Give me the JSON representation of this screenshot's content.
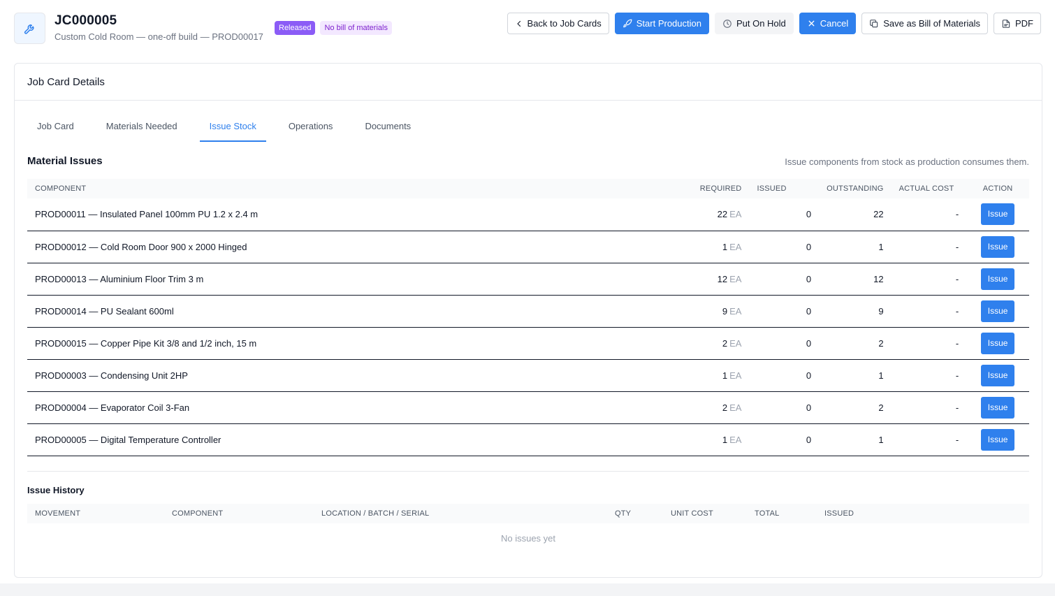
{
  "header": {
    "code": "JC000005",
    "subtitle": "Custom Cold Room — one-off build — PROD00017",
    "icon": "wrench-icon",
    "badges": {
      "status": "Released",
      "bom": "No bill of materials"
    }
  },
  "actions": {
    "back": "Back to Job Cards",
    "start": "Start Production",
    "hold": "Put On Hold",
    "cancel": "Cancel",
    "save_bom": "Save as Bill of Materials",
    "pdf": "PDF"
  },
  "card": {
    "title": "Job Card Details"
  },
  "tabs": [
    "Job Card",
    "Materials Needed",
    "Issue Stock",
    "Operations",
    "Documents"
  ],
  "active_tab": "Issue Stock",
  "material_issues": {
    "title": "Material Issues",
    "hint": "Issue components from stock as production consumes them.",
    "columns": [
      "Component",
      "Required",
      "Issued",
      "Outstanding",
      "Actual Cost",
      "Action"
    ],
    "rows": [
      {
        "component": "PROD00011 — Insulated Panel 100mm PU 1.2 x 2.4 m",
        "required": "22",
        "unit": "EA",
        "issued": "0",
        "outstanding": "22",
        "actual_cost": "-",
        "action": "Issue"
      },
      {
        "component": "PROD00012 — Cold Room Door 900 x 2000 Hinged",
        "required": "1",
        "unit": "EA",
        "issued": "0",
        "outstanding": "1",
        "actual_cost": "-",
        "action": "Issue"
      },
      {
        "component": "PROD00013 — Aluminium Floor Trim 3 m",
        "required": "12",
        "unit": "EA",
        "issued": "0",
        "outstanding": "12",
        "actual_cost": "-",
        "action": "Issue"
      },
      {
        "component": "PROD00014 — PU Sealant 600ml",
        "required": "9",
        "unit": "EA",
        "issued": "0",
        "outstanding": "9",
        "actual_cost": "-",
        "action": "Issue"
      },
      {
        "component": "PROD00015 — Copper Pipe Kit 3/8 and 1/2 inch, 15 m",
        "required": "2",
        "unit": "EA",
        "issued": "0",
        "outstanding": "2",
        "actual_cost": "-",
        "action": "Issue"
      },
      {
        "component": "PROD00003 — Condensing Unit 2HP",
        "required": "1",
        "unit": "EA",
        "issued": "0",
        "outstanding": "1",
        "actual_cost": "-",
        "action": "Issue"
      },
      {
        "component": "PROD00004 — Evaporator Coil 3-Fan",
        "required": "2",
        "unit": "EA",
        "issued": "0",
        "outstanding": "2",
        "actual_cost": "-",
        "action": "Issue"
      },
      {
        "component": "PROD00005 — Digital Temperature Controller",
        "required": "1",
        "unit": "EA",
        "issued": "0",
        "outstanding": "1",
        "actual_cost": "-",
        "action": "Issue"
      }
    ]
  },
  "issue_history": {
    "title": "Issue History",
    "columns": [
      "Movement",
      "Component",
      "Location / Batch / Serial",
      "Qty",
      "Unit Cost",
      "Total",
      "Issued"
    ],
    "empty": "No issues yet"
  },
  "colors": {
    "primary": "#2f80ed",
    "released": "#8b5cf6",
    "no_bom_bg": "#f3e8ff",
    "no_bom_text": "#7e22ce"
  }
}
